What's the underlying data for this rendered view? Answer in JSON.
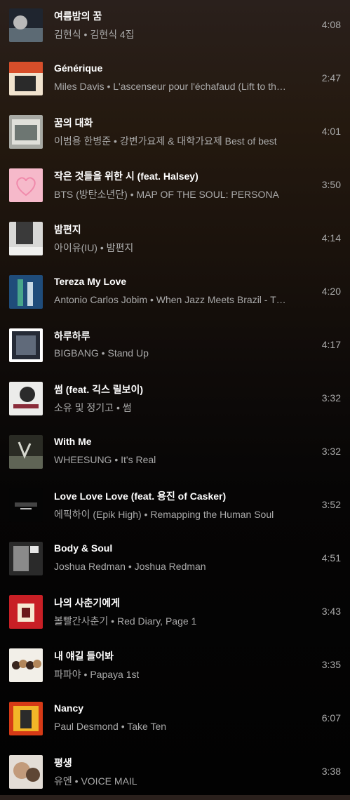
{
  "separator": " • ",
  "tracks": [
    {
      "title": "여름밤의 꿈",
      "artist": "김현식",
      "album": "김현식 4집",
      "duration": "4:08",
      "art": [
        "#1f252f",
        "#5c6a74",
        "#b9b9b9"
      ]
    },
    {
      "title": "Générique",
      "artist": "Miles Davis",
      "album": "L'ascenseur pour l'échafaud (Lift to the Scaffold)",
      "duration": "2:47",
      "art": [
        "#d74e2a",
        "#f1e3ce",
        "#2a2a2a"
      ]
    },
    {
      "title": "꿈의 대화",
      "artist": "이범용 한병준",
      "album": "강변가요제 & 대학가요제 Best of best",
      "duration": "4:01",
      "art": [
        "#a8aaa4",
        "#6d7672",
        "#e0e0da"
      ]
    },
    {
      "title": "작은 것들을 위한 시 (feat. Halsey)",
      "artist": "BTS (방탄소년단)",
      "album": "MAP OF THE SOUL: PERSONA",
      "duration": "3:50",
      "art": [
        "#f6b9ca",
        "#f08aab",
        "#fde5ec"
      ]
    },
    {
      "title": "밤편지",
      "artist": "아이유(IU)",
      "album": "밤편지",
      "duration": "4:14",
      "art": [
        "#d8d8d6",
        "#3a3a3a",
        "#f0f0ee"
      ]
    },
    {
      "title": "Tereza My Love",
      "artist": "Antonio Carlos Jobim",
      "album": "When Jazz Meets Brazil - The Collection",
      "duration": "4:20",
      "art": [
        "#1f4c7a",
        "#47a58a",
        "#c8d9e4"
      ]
    },
    {
      "title": "하루하루",
      "artist": "BIGBANG",
      "album": "Stand Up",
      "duration": "4:17",
      "art": [
        "#262b36",
        "#ffffff",
        "#606a7a"
      ]
    },
    {
      "title": "썸 (feat. 긱스 릴보이)",
      "artist": "소유 및 정기고",
      "album": "썸",
      "duration": "3:32",
      "art": [
        "#ececea",
        "#8a2c3a",
        "#2b2b2b"
      ]
    },
    {
      "title": "With Me",
      "artist": "WHEESUNG",
      "album": "It's Real",
      "duration": "3:32",
      "art": [
        "#2a2b24",
        "#5f6455",
        "#d6d8cf"
      ]
    },
    {
      "title": "Love Love Love (feat. 용진 of Casker)",
      "artist": "에픽하이 (Epik High)",
      "album": "Remapping the Human Soul",
      "duration": "3:52",
      "art": [
        "#050505",
        "#444444",
        "#bbbbbb"
      ]
    },
    {
      "title": "Body & Soul",
      "artist": "Joshua Redman",
      "album": "Joshua Redman",
      "duration": "4:51",
      "art": [
        "#2a2a2a",
        "#8a8a8a",
        "#e6e6e6"
      ]
    },
    {
      "title": "나의 사춘기에게",
      "artist": "볼빨간사춘기",
      "album": "Red Diary, Page 1",
      "duration": "3:43",
      "art": [
        "#c81f25",
        "#f6e9d2",
        "#6b1a1a"
      ]
    },
    {
      "title": "내 얘길 들어봐",
      "artist": "파파야",
      "album": "Papaya 1st",
      "duration": "3:35",
      "art": [
        "#f2efe8",
        "#b2865a",
        "#39261f"
      ]
    },
    {
      "title": "Nancy",
      "artist": "Paul Desmond",
      "album": "Take Ten",
      "duration": "6:07",
      "art": [
        "#d63a16",
        "#f2b628",
        "#2b2b2b"
      ]
    },
    {
      "title": "평생",
      "artist": "유엔",
      "album": "VOICE MAIL",
      "duration": "3:38",
      "art": [
        "#e3ddd6",
        "#c29b7b",
        "#5e4634"
      ]
    }
  ]
}
